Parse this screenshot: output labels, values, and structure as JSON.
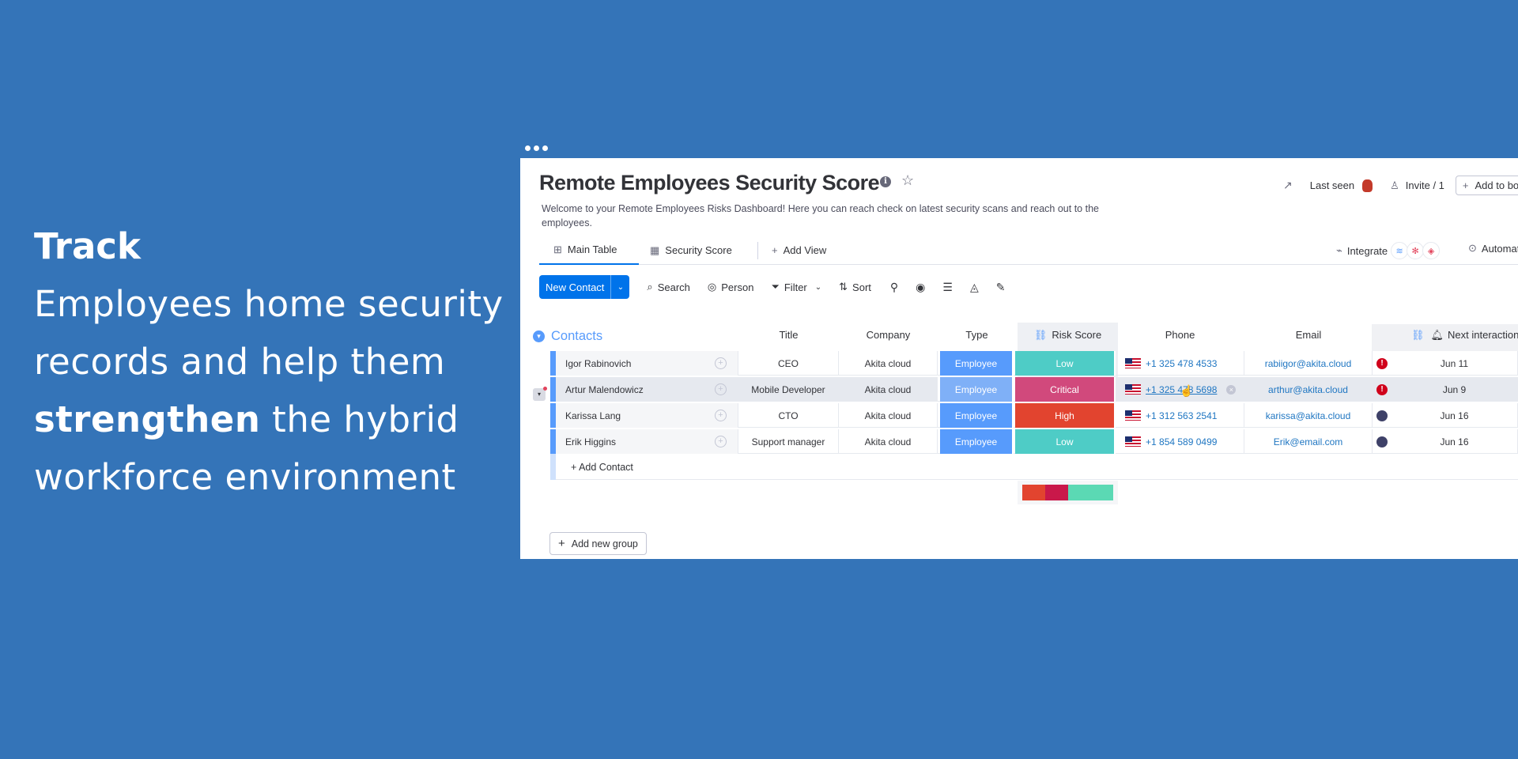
{
  "hero": {
    "line1": "Track",
    "line2": "Employees home security",
    "line3": "records and help them",
    "line4_bold": "strengthen",
    "line4_rest": " the hybrid",
    "line5": "workforce environment"
  },
  "board": {
    "title": "Remote Employees Security Score",
    "description": "Welcome to your Remote Employees Risks Dashboard! Here you can reach check on latest security scans and reach out to the employees.",
    "last_seen": "Last seen",
    "invite": "Invite / 1",
    "add_to_board": "Add to bo"
  },
  "tabs": {
    "main_table": "Main Table",
    "security_score": "Security Score",
    "add_view": "Add View",
    "integrate": "Integrate",
    "automate": "Automate /"
  },
  "toolbar": {
    "new_contact": "New Contact",
    "search": "Search",
    "person": "Person",
    "filter": "Filter",
    "sort": "Sort"
  },
  "group": {
    "name": "Contacts",
    "columns": {
      "title": "Title",
      "company": "Company",
      "type": "Type",
      "risk_score": "Risk Score",
      "phone": "Phone",
      "email": "Email",
      "next_interaction": "Next interaction"
    },
    "rows": [
      {
        "name": "Igor Rabinovich",
        "title": "CEO",
        "company": "Akita cloud",
        "type": "Employee",
        "risk": "Low",
        "risk_color": "#4eccc6",
        "phone": "+1 325 478 4533",
        "email": "rabiigor@akita.cloud",
        "alert": "red",
        "next": "Jun 11"
      },
      {
        "name": "Artur Malendowicz",
        "title": "Mobile Developer",
        "company": "Akita cloud",
        "type": "Employee",
        "risk": "Critical",
        "risk_color": "#d1497c",
        "phone": "+1 325 478 5698",
        "email": "arthur@akita.cloud",
        "alert": "red",
        "next": "Jun 9"
      },
      {
        "name": "Karissa Lang",
        "title": "CTO",
        "company": "Akita cloud",
        "type": "Employee",
        "risk": "High",
        "risk_color": "#e2442f",
        "phone": "+1 312 563 2541",
        "email": "karissa@akita.cloud",
        "alert": "dark",
        "next": "Jun 16"
      },
      {
        "name": "Erik Higgins",
        "title": "Support manager",
        "company": "Akita cloud",
        "type": "Employee",
        "risk": "Low",
        "risk_color": "#4eccc6",
        "phone": "+1 854 589 0499",
        "email": "Erik@email.com",
        "alert": "dark",
        "next": "Jun 16"
      }
    ],
    "add_contact": "+ Add Contact",
    "risk_summary": [
      {
        "label": "High",
        "fraction": 0.25,
        "color": "#e2442f"
      },
      {
        "label": "Critical",
        "fraction": 0.25,
        "color": "#c9184a"
      },
      {
        "label": "Low",
        "fraction": 0.5,
        "color": "#5bd9b4"
      }
    ]
  },
  "add_new_group": "Add new group",
  "colors": {
    "background": "#3474b8",
    "accent": "#0073ea",
    "group": "#579bfc"
  }
}
